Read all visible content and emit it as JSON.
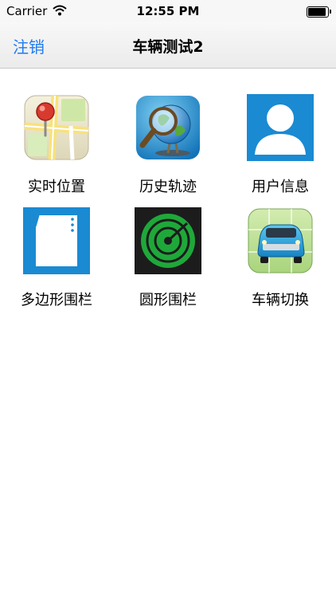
{
  "status_bar": {
    "carrier": "Carrier",
    "time": "12:55 PM",
    "battery_level": 1.0
  },
  "nav": {
    "left_button": "注销",
    "title": "车辆测试2"
  },
  "menu": [
    {
      "label": "实时位置",
      "icon": "map-pin-icon"
    },
    {
      "label": "历史轨迹",
      "icon": "globe-search-icon"
    },
    {
      "label": "用户信息",
      "icon": "user-icon"
    },
    {
      "label": "多边形围栏",
      "icon": "polygon-fence-icon"
    },
    {
      "label": "圆形围栏",
      "icon": "radar-icon"
    },
    {
      "label": "车辆切换",
      "icon": "car-icon"
    }
  ]
}
